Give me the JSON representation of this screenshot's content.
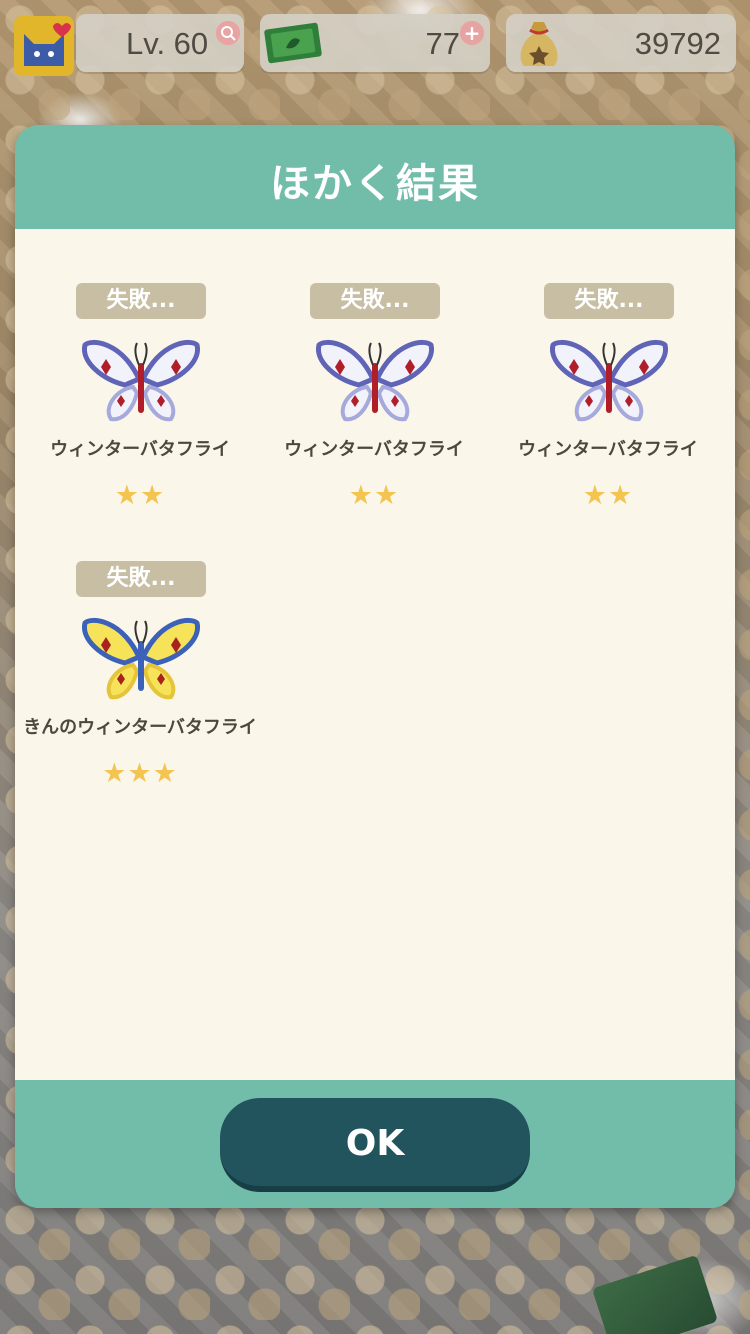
{
  "hud": {
    "level_label": "Lv. 60",
    "tickets": "77",
    "bells": "39792"
  },
  "dialog": {
    "title": "ほかく結果",
    "ok_label": "OK"
  },
  "results": [
    {
      "status": "失敗...",
      "name": "ウィンターバタフライ",
      "stars": "★★",
      "variant": "white"
    },
    {
      "status": "失敗...",
      "name": "ウィンターバタフライ",
      "stars": "★★",
      "variant": "white"
    },
    {
      "status": "失敗...",
      "name": "ウィンターバタフライ",
      "stars": "★★",
      "variant": "white"
    },
    {
      "status": "失敗...",
      "name": "きんのウィンターバタフライ",
      "stars": "★★★",
      "variant": "gold"
    }
  ],
  "colors": {
    "dialog_header": "#72bcaa",
    "dialog_body": "#faf6e9",
    "ok_button": "#22545d",
    "star": "#f4c450",
    "status_badge": "#c7bea3"
  },
  "icons": {
    "avatar": "cat-heart-icon",
    "level_badge": "search-plus-icon",
    "ticket": "leaf-ticket-icon",
    "ticket_add": "plus-icon",
    "bells": "bell-bag-icon",
    "item": "butterfly-icon"
  }
}
